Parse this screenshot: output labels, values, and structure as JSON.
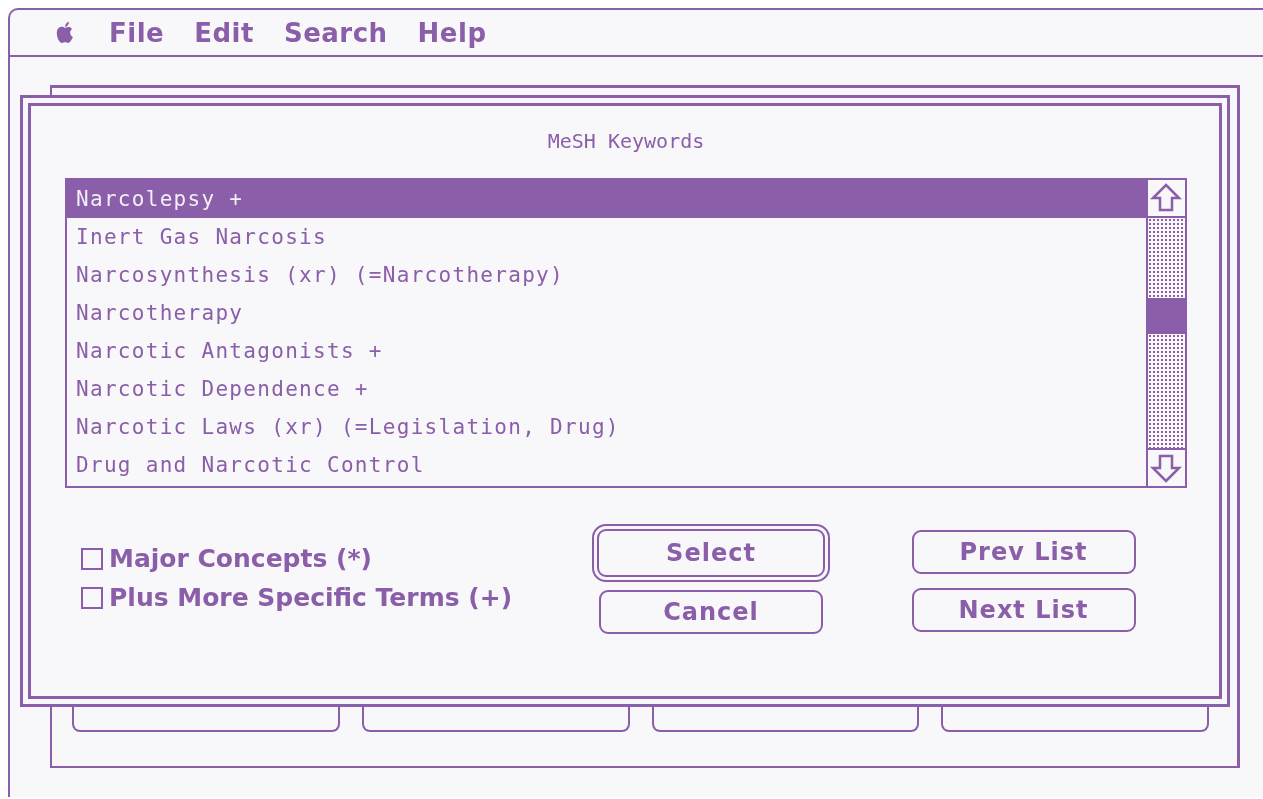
{
  "menu_bar": {
    "items": [
      "File",
      "Edit",
      "Search",
      "Help"
    ]
  },
  "dialog": {
    "title": "MeSH Keywords",
    "list": [
      {
        "label": "Narcolepsy +",
        "selected": true
      },
      {
        "label": "Inert Gas Narcosis",
        "selected": false
      },
      {
        "label": "Narcosynthesis (xr) (=Narcotherapy)",
        "selected": false
      },
      {
        "label": "Narcotherapy",
        "selected": false
      },
      {
        "label": "Narcotic Antagonists +",
        "selected": false
      },
      {
        "label": "Narcotic Dependence +",
        "selected": false
      },
      {
        "label": "Narcotic Laws (xr) (=Legislation, Drug)",
        "selected": false
      },
      {
        "label": "Drug and Narcotic Control",
        "selected": false
      }
    ],
    "options": [
      {
        "label": "Major Concepts (*)",
        "checked": false
      },
      {
        "label": "Plus More Specific Terms (+)",
        "checked": false
      }
    ],
    "buttons": [
      {
        "label": "Select",
        "default": true
      },
      {
        "label": "Cancel",
        "default": false
      }
    ],
    "list_buttons": [
      {
        "label": "Prev List"
      },
      {
        "label": "Next List"
      }
    ]
  }
}
